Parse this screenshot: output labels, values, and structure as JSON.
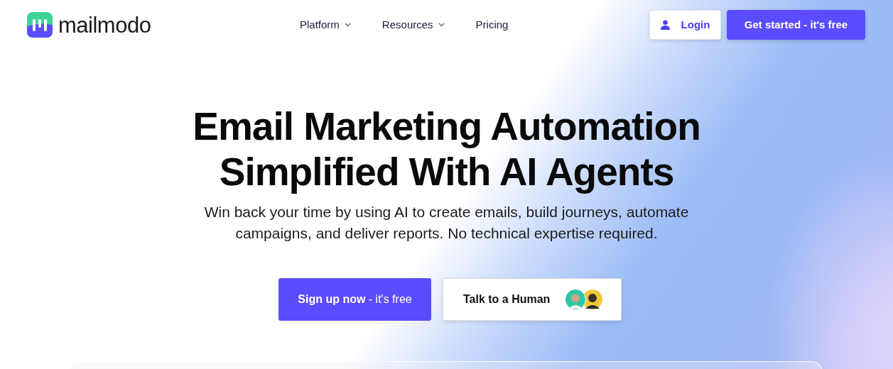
{
  "brand": {
    "name": "mailmodo"
  },
  "nav": [
    {
      "label": "Platform",
      "has_menu": true
    },
    {
      "label": "Resources",
      "has_menu": true
    },
    {
      "label": "Pricing",
      "has_menu": false
    }
  ],
  "header_buttons": [
    {
      "label": "Login",
      "kind": "outline"
    },
    {
      "label": "Get started - it's free",
      "kind": "primary"
    }
  ],
  "hero": {
    "title_lines": [
      "Email Marketing Automation",
      "Simplified With AI Agents"
    ],
    "subtitle": "Win back your time by using AI to create emails, build journeys, automate campaigns, and deliver reports. No technical expertise required.",
    "buttons": [
      {
        "label": "**Sign up now** - it's free",
        "kind": "primary"
      },
      {
        "label": "Talk to a Human",
        "kind": "outline"
      }
    ]
  }
}
